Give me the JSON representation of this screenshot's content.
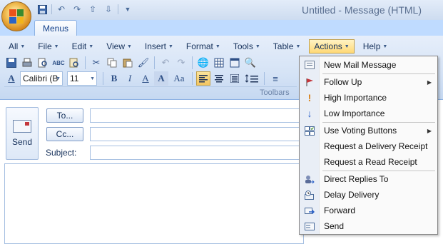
{
  "window": {
    "title": "Untitled - Message (HTML)"
  },
  "qat": {
    "customize_icon": "dropdown-chevron"
  },
  "tabs": {
    "menus_label": "Menus"
  },
  "menubar": {
    "items": [
      {
        "label": "All"
      },
      {
        "label": "File"
      },
      {
        "label": "Edit"
      },
      {
        "label": "View"
      },
      {
        "label": "Insert"
      },
      {
        "label": "Format"
      },
      {
        "label": "Tools"
      },
      {
        "label": "Table"
      },
      {
        "label": "Actions"
      },
      {
        "label": "Help"
      }
    ]
  },
  "toolbar": {
    "font_name": "Calibri (B",
    "font_size": "11",
    "bold": "B",
    "italic": "I",
    "underline": "A",
    "highlight": "A",
    "change_case": "Aa",
    "group_label": "Toolbars"
  },
  "compose": {
    "send_label": "Send",
    "to_label": "To...",
    "cc_label": "Cc...",
    "subject_label": "Subject:"
  },
  "actions_menu": {
    "items": [
      {
        "label": "New Mail Message",
        "icon": "new-mail-icon",
        "has_submenu": false
      },
      {
        "label": "Follow Up",
        "icon": "flag-icon",
        "has_submenu": true
      },
      {
        "label": "High Importance",
        "icon": "exclamation-icon",
        "has_submenu": false
      },
      {
        "label": "Low Importance",
        "icon": "down-arrow-icon",
        "has_submenu": false
      },
      {
        "label": "Use Voting Buttons",
        "icon": "voting-icon",
        "has_submenu": true
      },
      {
        "label": "Request a Delivery Receipt",
        "icon": "",
        "has_submenu": false
      },
      {
        "label": "Request a Read Receipt",
        "icon": "",
        "has_submenu": false
      },
      {
        "label": "Direct Replies To",
        "icon": "direct-replies-icon",
        "has_submenu": false
      },
      {
        "label": "Delay Delivery",
        "icon": "delay-delivery-icon",
        "has_submenu": false
      },
      {
        "label": "Forward",
        "icon": "forward-icon",
        "has_submenu": false
      },
      {
        "label": "Send",
        "icon": "send-icon",
        "has_submenu": false
      }
    ]
  },
  "colors": {
    "ribbon": "#d5e3f6",
    "active_menu": "#ffd976",
    "flag": "#c4373c",
    "importance_high": "#d9821b",
    "importance_low": "#2d62c8"
  }
}
